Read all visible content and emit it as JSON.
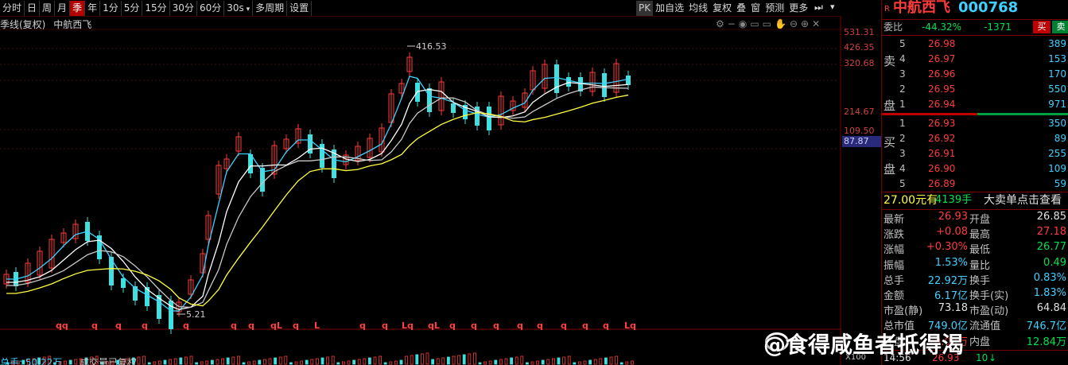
{
  "toolbar": {
    "items": [
      {
        "label": "分时",
        "active": false
      },
      {
        "label": "日",
        "active": false
      },
      {
        "label": "周",
        "active": false
      },
      {
        "label": "月",
        "active": false
      },
      {
        "label": "季",
        "active": true
      },
      {
        "label": "年",
        "active": false
      },
      {
        "label": "1分",
        "active": false
      },
      {
        "label": "5分",
        "active": false
      },
      {
        "label": "15分",
        "active": false
      },
      {
        "label": "30分",
        "active": false
      },
      {
        "label": "60分",
        "active": false
      },
      {
        "label": "30s",
        "active": false,
        "dropdown": true
      },
      {
        "label": "多周期",
        "active": false
      },
      {
        "label": "设置",
        "active": false
      }
    ],
    "right_items": [
      "PK",
      "加自选",
      "均线",
      "复权",
      "叠",
      "窗",
      "预测",
      "更多"
    ]
  },
  "chart_header": {
    "period_label": "季线(复权)",
    "stock_name": "中航西飞"
  },
  "volume_header": {
    "label": "总手: 50.22万",
    "note": "成交量已复权"
  },
  "colors": {
    "up": "#ff3b3b",
    "down": "#40e0e0",
    "ma5": "#ffffff",
    "ma10": "#c8c8c8",
    "ma20": "#ffff40",
    "ma_alt": "#40d0ff"
  },
  "chart_data": {
    "type": "candlestick",
    "y_scale": "log",
    "y_ticks": [
      "531.31",
      "426.35",
      "320.68",
      "214.67",
      "109.50"
    ],
    "current_price_label": "87.87",
    "high_marker": "416.53",
    "low_marker": "5.21",
    "bottom_markers": [
      "qq",
      "q",
      "q",
      "q",
      "q",
      "q",
      "q",
      "qL",
      "q",
      "L",
      "q",
      "q",
      "Lq",
      "qL",
      "q",
      "q",
      "q",
      "q",
      "q",
      "q",
      "q",
      "q",
      "Lq"
    ],
    "volume_axis_label": "X100"
  },
  "panel": {
    "code_prefix": "R",
    "name": "中航西飞",
    "code": "000768",
    "weibi": {
      "label": "委比",
      "pct": "-44.32%",
      "diff": "-1371",
      "sell_btn": "买",
      "buy_btn": "卖"
    },
    "sell_label": [
      "卖",
      "盘"
    ],
    "buy_label": [
      "买",
      "盘"
    ],
    "sells": [
      {
        "n": "5",
        "price": "26.98",
        "vol": "389"
      },
      {
        "n": "4",
        "price": "26.97",
        "vol": "153"
      },
      {
        "n": "3",
        "price": "26.96",
        "vol": "170"
      },
      {
        "n": "2",
        "price": "26.95",
        "vol": "550"
      },
      {
        "n": "1",
        "price": "26.94",
        "vol": "971"
      }
    ],
    "buys": [
      {
        "n": "1",
        "price": "26.93",
        "vol": "350"
      },
      {
        "n": "2",
        "price": "26.92",
        "vol": "89"
      },
      {
        "n": "3",
        "price": "26.91",
        "vol": "255"
      },
      {
        "n": "4",
        "price": "26.90",
        "vol": "109"
      },
      {
        "n": "5",
        "price": "26.89",
        "vol": "59"
      }
    ],
    "big_order": {
      "price": "27.00元有",
      "vol": "4139手",
      "text": "大卖单点击查看"
    },
    "stats": [
      {
        "k1": "最新",
        "v1": "26.93",
        "c1": "red",
        "k2": "开盘",
        "v2": "26.85",
        "c2": "white"
      },
      {
        "k1": "涨跌",
        "v1": "+0.08",
        "c1": "red",
        "k2": "最高",
        "v2": "27.18",
        "c2": "red"
      },
      {
        "k1": "涨幅",
        "v1": "+0.30%",
        "c1": "red",
        "k2": "最低",
        "v2": "26.77",
        "c2": "green"
      },
      {
        "k1": "振幅",
        "v1": "1.53%",
        "c1": "cyan",
        "k2": "量比",
        "v2": "0.49",
        "c2": "green"
      },
      {
        "k1": "总手",
        "v1": "22.92万",
        "c1": "cyan",
        "k2": "换手",
        "v2": "0.83%",
        "c2": "cyan"
      },
      {
        "k1": "金额",
        "v1": "6.17亿",
        "c1": "cyan",
        "k2": "换手(实)",
        "v2": "1.83%",
        "c2": "cyan"
      },
      {
        "k1": "市盈(静)",
        "v1": "73.18",
        "c1": "white",
        "k2": "市盈(动)",
        "v2": "64.84",
        "c2": "white"
      },
      {
        "k1": "总市值",
        "v1": "749.0亿",
        "c1": "cyan",
        "k2": "流通值",
        "v2": "746.7亿",
        "c2": "cyan"
      },
      {
        "k1": "外盘",
        "v1": "10.08万",
        "c1": "red",
        "k2": "内盘",
        "v2": "12.84万",
        "c2": "green"
      }
    ],
    "tick": {
      "time": "14:56",
      "price": "26.93",
      "vol": "10"
    }
  },
  "watermark": "@食得咸鱼者抵得渴"
}
